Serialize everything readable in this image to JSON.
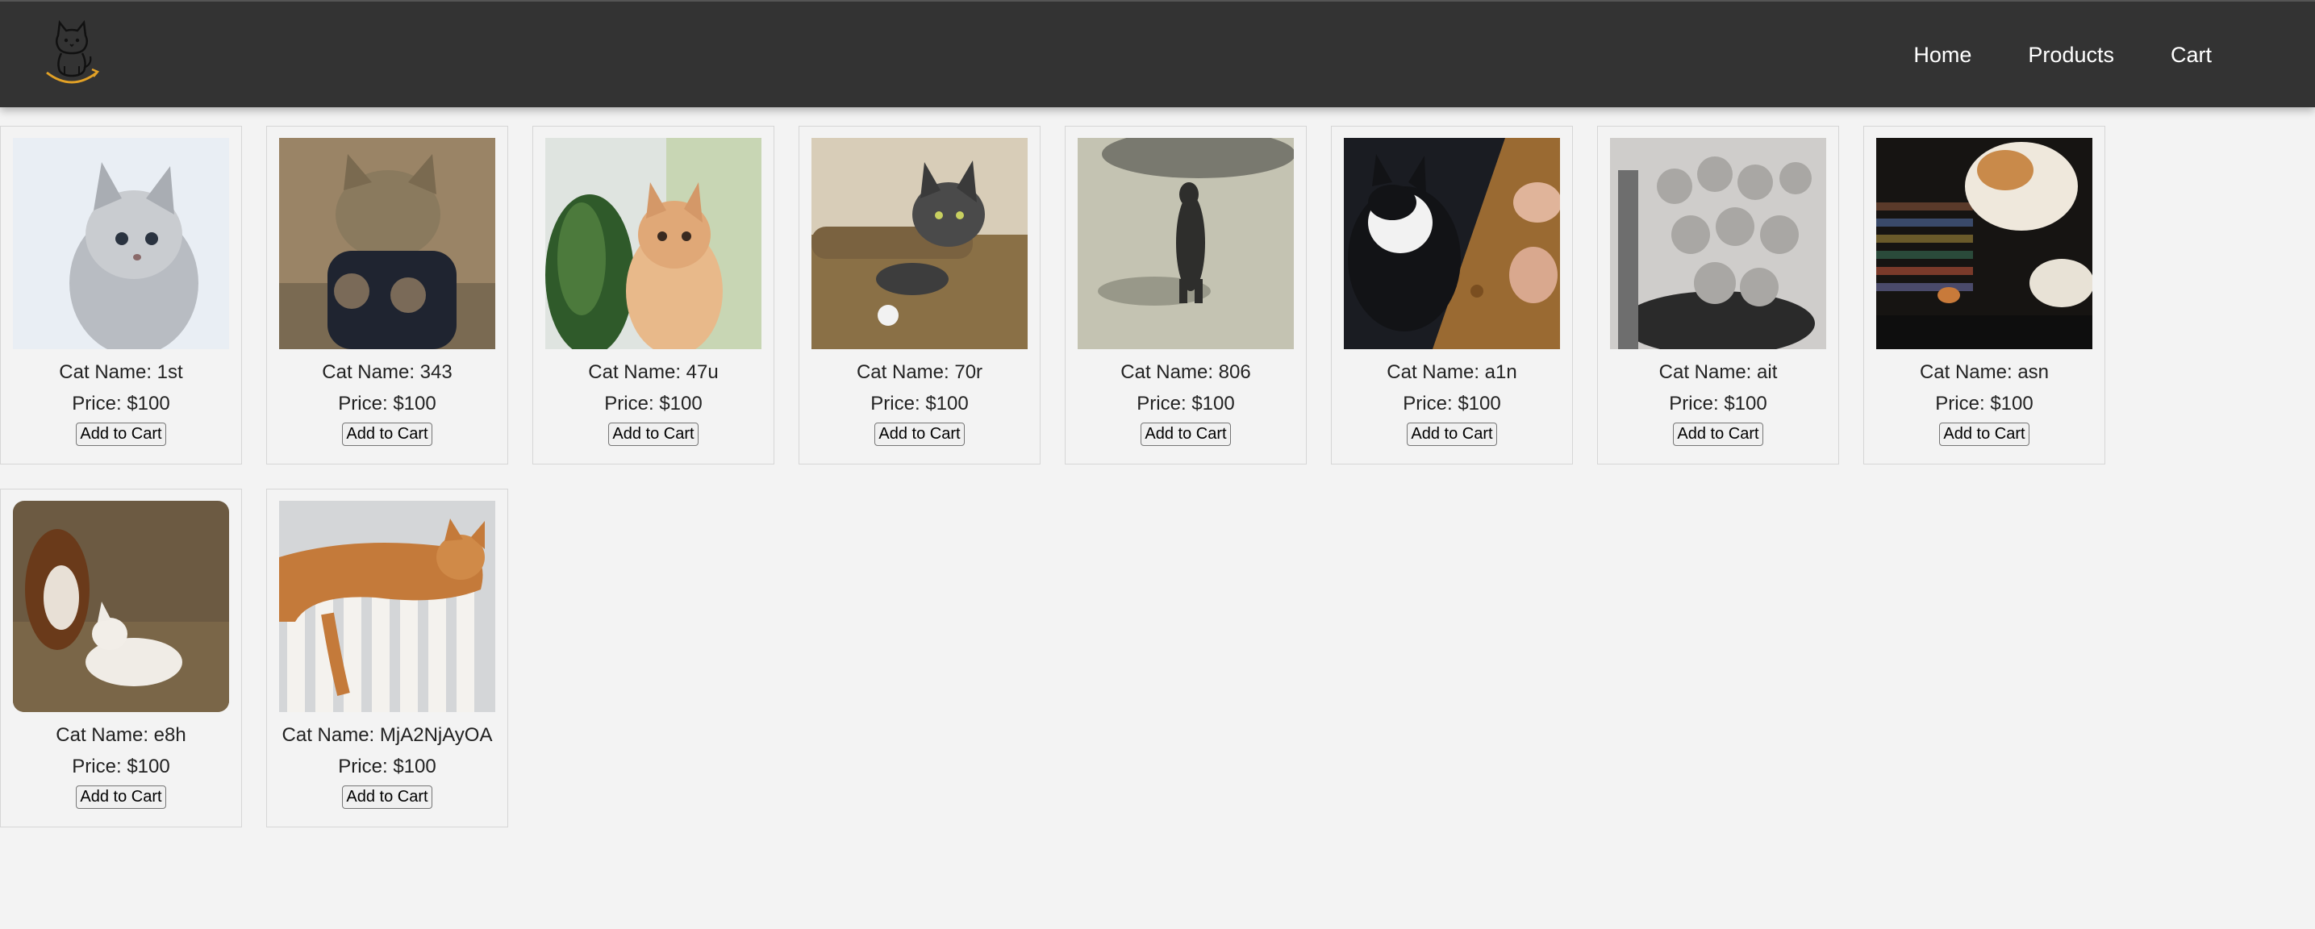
{
  "nav": {
    "logo_icon": "cat-logo-icon",
    "links": [
      "Home",
      "Products",
      "Cart"
    ]
  },
  "products": [
    {
      "name": "Cat Name: 1st",
      "price": "Price: $100",
      "button": "Add to Cart",
      "image": "kitten-photo"
    },
    {
      "name": "Cat Name: 343",
      "price": "Price: $100",
      "button": "Add to Cart",
      "image": "cat-photo"
    },
    {
      "name": "Cat Name: 47u",
      "price": "Price: $100",
      "button": "Add to Cart",
      "image": "cat-photo"
    },
    {
      "name": "Cat Name: 70r",
      "price": "Price: $100",
      "button": "Add to Cart",
      "image": "cat-photo"
    },
    {
      "name": "Cat Name: 806",
      "price": "Price: $100",
      "button": "Add to Cart",
      "image": "cat-photo"
    },
    {
      "name": "Cat Name: a1n",
      "price": "Price: $100",
      "button": "Add to Cart",
      "image": "cat-photo"
    },
    {
      "name": "Cat Name: ait",
      "price": "Price: $100",
      "button": "Add to Cart",
      "image": "kittens-photo"
    },
    {
      "name": "Cat Name: asn",
      "price": "Price: $100",
      "button": "Add to Cart",
      "image": "cat-photo"
    },
    {
      "name": "Cat Name: e8h",
      "price": "Price: $100",
      "button": "Add to Cart",
      "image": "cats-photo"
    },
    {
      "name": "Cat Name: MjA2NjAyOA",
      "price": "Price: $100",
      "button": "Add to Cart",
      "image": "cat-photo"
    }
  ]
}
